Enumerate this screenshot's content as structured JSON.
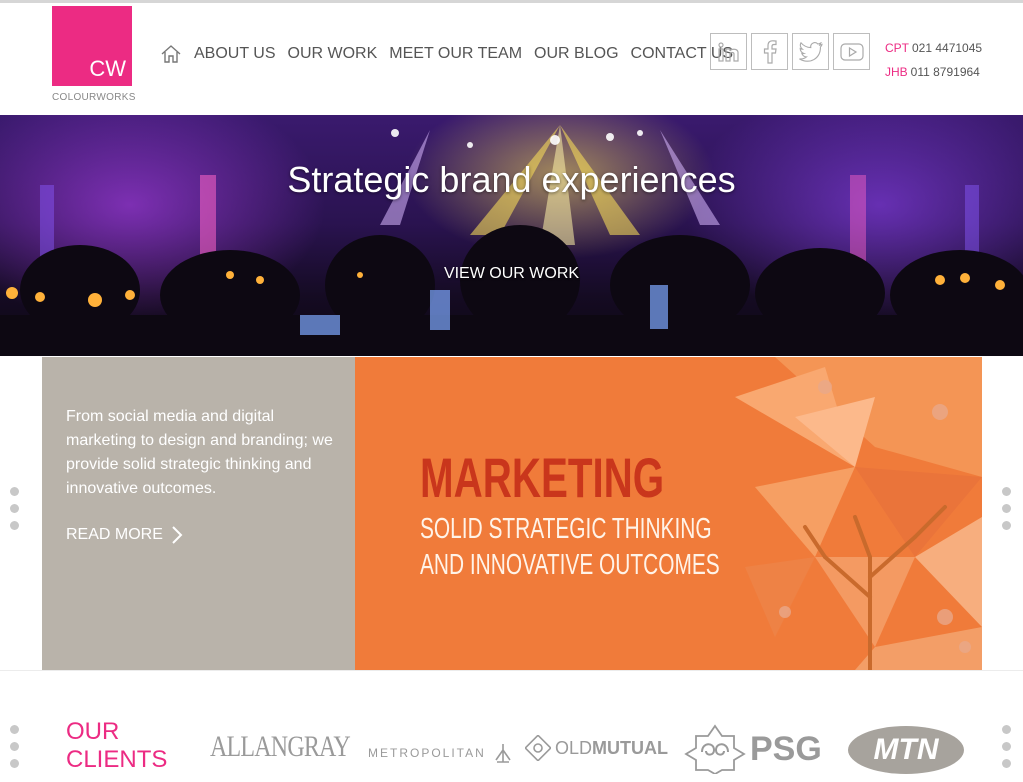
{
  "brand": {
    "logo_mark": "CW",
    "logo_word": "COLOURWORKS",
    "accent": "#ec2b83"
  },
  "nav": {
    "home_icon": "home-icon",
    "items": [
      "ABOUT US",
      "OUR WORK",
      "MEET OUR TEAM",
      "OUR BLOG",
      "CONTACT US"
    ]
  },
  "social": [
    "linkedin-icon",
    "facebook-icon",
    "twitter-icon",
    "youtube-icon"
  ],
  "contacts": [
    {
      "city": "CPT",
      "number": "021 4471045"
    },
    {
      "city": "JHB",
      "number": "011 8791964"
    }
  ],
  "hero": {
    "title": "Strategic brand experiences",
    "cta": "VIEW OUR WORK"
  },
  "feature": {
    "text": "From social media and digital marketing to design and branding; we provide solid strategic thinking and innovative outcomes.",
    "read_more": "READ MORE",
    "heading": "MARKETING",
    "sub_line1": "SOLID STRATEGIC THINKING",
    "sub_line2": "AND INNOVATIVE OUTCOMES",
    "colors": {
      "panel_grey": "#b9b3aa",
      "panel_orange": "#f07b3a",
      "heading": "#c9361c"
    }
  },
  "clients": {
    "title_line1": "OUR",
    "title_line2": "CLIENTS",
    "logos": {
      "allan_gray": "ALLANGRAY",
      "metropolitan": "METROPOLITAN",
      "old_mutual_a": "OLD",
      "old_mutual_b": "MUTUAL",
      "psg": "PSG",
      "mtn": "MTN"
    }
  }
}
